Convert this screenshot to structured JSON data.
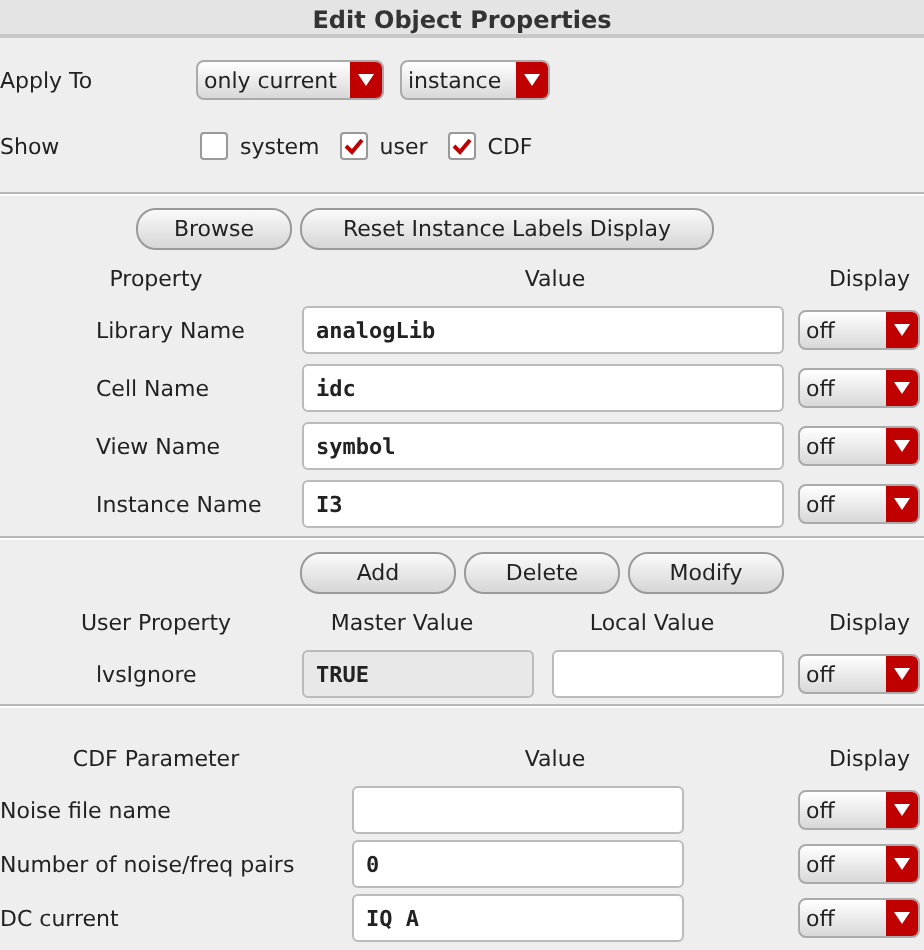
{
  "window": {
    "title": "Edit Object Properties"
  },
  "apply_to": {
    "label": "Apply To",
    "dropdowns": [
      {
        "value": "only current"
      },
      {
        "value": "instance"
      }
    ]
  },
  "show": {
    "label": "Show",
    "options": [
      {
        "label": "system",
        "checked": false
      },
      {
        "label": "user",
        "checked": true
      },
      {
        "label": "CDF",
        "checked": true
      }
    ]
  },
  "property_buttons": [
    "Browse",
    "Reset Instance Labels Display"
  ],
  "properties": {
    "columns": [
      "Property",
      "Value",
      "Display"
    ],
    "rows": [
      {
        "name": "Library Name",
        "value": "analogLib",
        "display": "off"
      },
      {
        "name": "Cell Name",
        "value": "idc",
        "display": "off"
      },
      {
        "name": "View Name",
        "value": "symbol",
        "display": "off"
      },
      {
        "name": "Instance Name",
        "value": "I3",
        "display": "off"
      }
    ]
  },
  "user_property_buttons": [
    "Add",
    "Delete",
    "Modify"
  ],
  "user_properties": {
    "columns": [
      "User Property",
      "Master Value",
      "Local Value",
      "Display"
    ],
    "rows": [
      {
        "name": "lvsIgnore",
        "master_value": "TRUE",
        "display": "off"
      }
    ]
  },
  "cdf_parameters": {
    "columns": [
      "CDF Parameter",
      "Value",
      "Display"
    ],
    "rows": [
      {
        "name": "Noise file name",
        "display": "off"
      },
      {
        "name": "Number of noise/freq pairs",
        "value": "0",
        "display": "off"
      },
      {
        "name": "DC current",
        "value": "IQ A",
        "display": "off"
      }
    ]
  }
}
